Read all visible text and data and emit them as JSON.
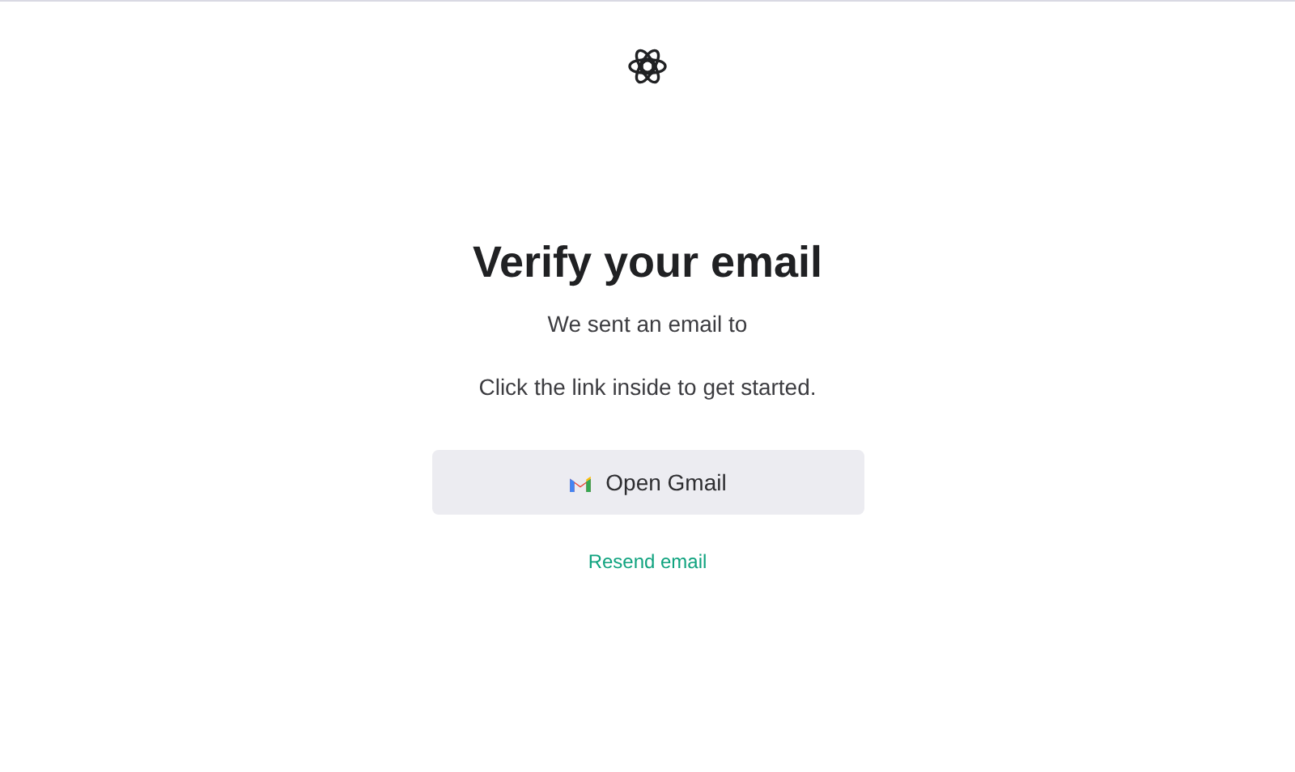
{
  "title": "Verify your email",
  "message": "We sent an email to",
  "instruction": "Click the link inside to get started.",
  "open_button": {
    "label": "Open Gmail"
  },
  "resend_link": {
    "label": "Resend email"
  }
}
